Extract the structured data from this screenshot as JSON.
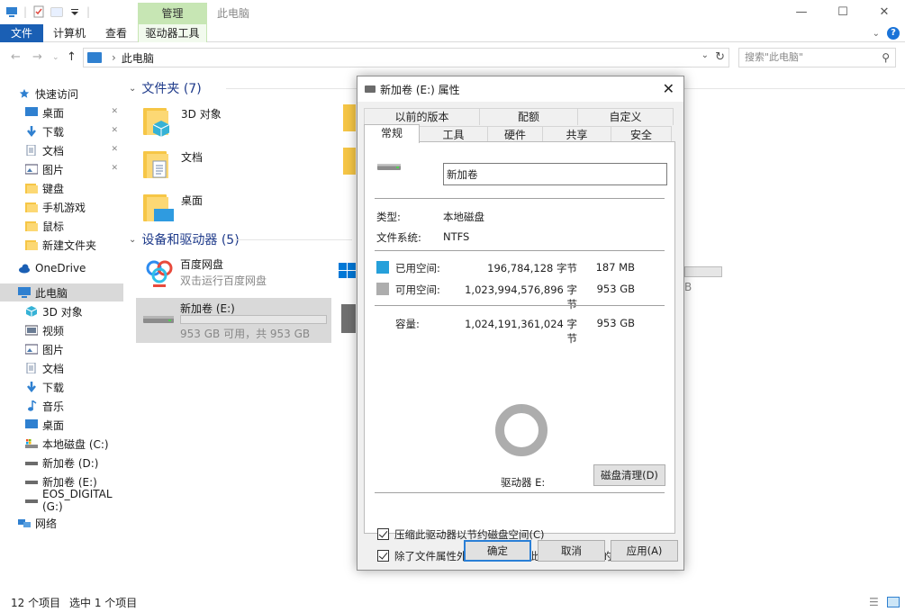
{
  "window": {
    "title": "此电脑",
    "manage_tab": "管理"
  },
  "ribbon": {
    "tabs": [
      "文件",
      "计算机",
      "查看",
      "驱动器工具"
    ]
  },
  "address": {
    "path": "此电脑",
    "search_placeholder": "搜索\"此电脑\""
  },
  "sidebar": {
    "items": [
      {
        "label": "快速访问",
        "icon": "star-icon"
      },
      {
        "label": "桌面",
        "icon": "desktop-icon",
        "pinned": true
      },
      {
        "label": "下载",
        "icon": "download-icon",
        "pinned": true
      },
      {
        "label": "文档",
        "icon": "document-icon",
        "pinned": true
      },
      {
        "label": "图片",
        "icon": "pictures-icon",
        "pinned": true
      },
      {
        "label": "键盘",
        "icon": "folder-icon"
      },
      {
        "label": "手机游戏",
        "icon": "folder-icon"
      },
      {
        "label": "鼠标",
        "icon": "folder-icon"
      },
      {
        "label": "新建文件夹",
        "icon": "folder-icon"
      },
      {
        "label": "OneDrive",
        "icon": "cloud-icon"
      },
      {
        "label": "此电脑",
        "icon": "computer-icon"
      },
      {
        "label": "3D 对象",
        "icon": "3d-objects-icon"
      },
      {
        "label": "视频",
        "icon": "video-icon"
      },
      {
        "label": "图片",
        "icon": "pictures-icon"
      },
      {
        "label": "文档",
        "icon": "document-icon"
      },
      {
        "label": "下载",
        "icon": "download-icon"
      },
      {
        "label": "音乐",
        "icon": "music-icon"
      },
      {
        "label": "桌面",
        "icon": "desktop-icon"
      },
      {
        "label": "本地磁盘 (C:)",
        "icon": "system-drive-icon"
      },
      {
        "label": "新加卷 (D:)",
        "icon": "drive-icon"
      },
      {
        "label": "新加卷 (E:)",
        "icon": "drive-icon"
      },
      {
        "label": "EOS_DIGITAL (G:)",
        "icon": "drive-icon"
      },
      {
        "label": "网络",
        "icon": "network-icon"
      }
    ]
  },
  "content": {
    "folders_header": "文件夹 (7)",
    "folders": [
      "3D 对象",
      "文档",
      "桌面"
    ],
    "devices_header": "设备和驱动器 (5)",
    "devices": [
      {
        "name": "百度网盘",
        "sub": "双击运行百度网盘"
      },
      {
        "name": "新加卷 (E:)",
        "sub": "953 GB 可用，共 953 GB"
      }
    ],
    "partial_right": "B"
  },
  "status": {
    "count": "12 个项目",
    "selected": "选中 1 个项目"
  },
  "dialog": {
    "title": "新加卷 (E:) 属性",
    "tabs_top": [
      "以前的版本",
      "配额",
      "自定义"
    ],
    "tabs_bottom": [
      "常规",
      "工具",
      "硬件",
      "共享",
      "安全"
    ],
    "volume_name": "新加卷",
    "type_label": "类型:",
    "type_value": "本地磁盘",
    "fs_label": "文件系统:",
    "fs_value": "NTFS",
    "used_label": "已用空间:",
    "used_bytes": "196,784,128 字节",
    "used_size": "187 MB",
    "free_label": "可用空间:",
    "free_bytes": "1,023,994,576,896 字节",
    "free_size": "953 GB",
    "capacity_label": "容量:",
    "capacity_bytes": "1,024,191,361,024 字节",
    "capacity_size": "953 GB",
    "drive_label": "驱动器 E:",
    "cleanup_button": "磁盘清理(D)",
    "compress_label": "压缩此驱动器以节约磁盘空间(C)",
    "index_label": "除了文件属性外，还允许索引此驱动器上文件的内容(I)",
    "ok_button": "确定",
    "cancel_button": "取消",
    "apply_button": "应用(A)",
    "used_fraction": 0.0002,
    "colors": {
      "used": "#26a0da",
      "free": "#adadad"
    }
  }
}
